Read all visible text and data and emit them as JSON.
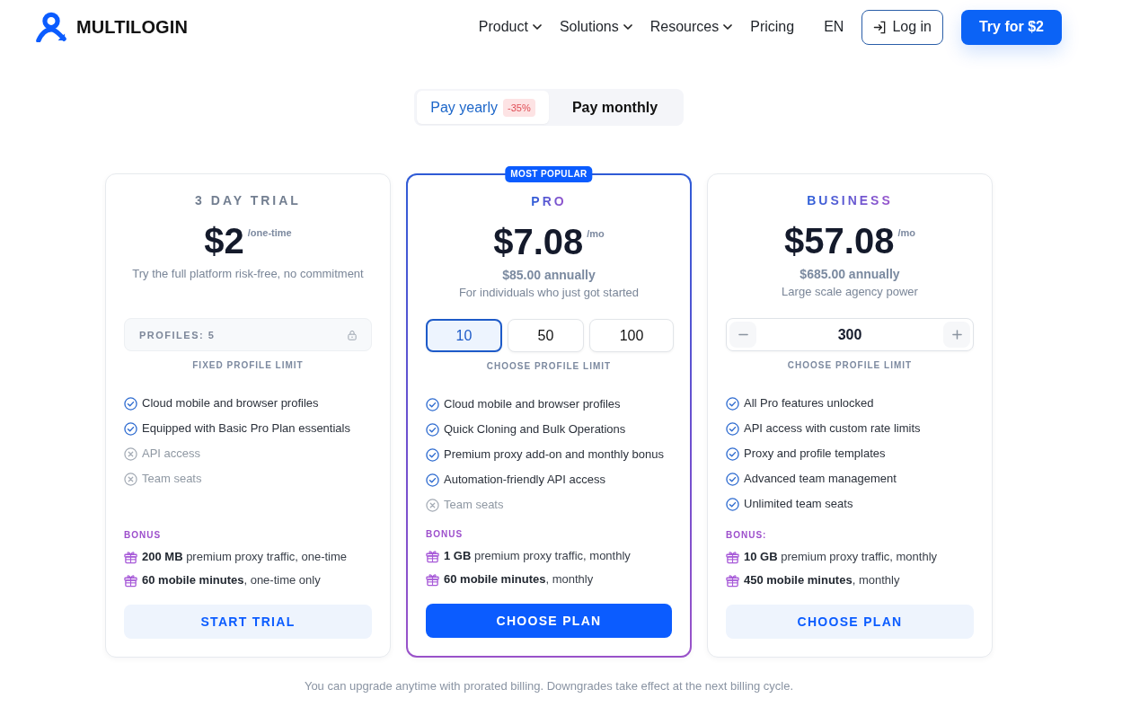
{
  "header": {
    "logo": "MULTILOGIN",
    "nav": [
      {
        "label": "Product",
        "dropdown": true
      },
      {
        "label": "Solutions",
        "dropdown": true
      },
      {
        "label": "Resources",
        "dropdown": true
      },
      {
        "label": "Pricing",
        "dropdown": false
      }
    ],
    "language": "EN",
    "login": "Log in",
    "cta": "Try for $2"
  },
  "billing_toggle": [
    {
      "label": "Pay yearly",
      "badge": "-35%",
      "selected": true
    },
    {
      "label": "Pay monthly",
      "selected": false
    }
  ],
  "plans": [
    {
      "name": "3 DAY TRIAL",
      "accent": false,
      "featured": false,
      "price": "$2",
      "period": "/one-time",
      "tagline": "Try the full platform risk-free, no commitment",
      "profile_limit": {
        "kind": "fixed",
        "value": "PROFILES: 5",
        "locked": true,
        "caption": "FIXED PROFILE LIMIT"
      },
      "features": [
        {
          "text": "Cloud mobile and browser profiles",
          "included": true
        },
        {
          "text": "Equipped with Basic Pro Plan essentials",
          "included": true
        },
        {
          "text": "API access",
          "included": false
        },
        {
          "text": "Team seats",
          "included": false
        }
      ],
      "bonus_label": "BONUS",
      "bonuses": [
        "**200 MB** premium proxy traffic, one-time",
        "**60 mobile minutes**, one-time only"
      ],
      "button": "START TRIAL"
    },
    {
      "name": "PRO",
      "accent": true,
      "featured": true,
      "ribbon": "MOST POPULAR",
      "price": "$7.08",
      "period": "/mo",
      "annual": "$85.00 annually",
      "tagline": "For individuals who just got started",
      "profile_limit": {
        "kind": "options",
        "options": [
          {
            "label": "10",
            "selected": true
          },
          {
            "label": "50",
            "selected": false
          },
          {
            "label": "100",
            "selected": false
          }
        ],
        "caption": "CHOOSE PROFILE LIMIT"
      },
      "features": [
        {
          "text": "Cloud mobile and browser profiles",
          "included": true
        },
        {
          "text": "Quick Cloning and Bulk Operations",
          "included": true
        },
        {
          "text": "Premium proxy add-on and monthly bonus",
          "included": true
        },
        {
          "text": "Automation-friendly API access",
          "included": true
        },
        {
          "text": "Team seats",
          "included": false
        }
      ],
      "bonus_label": "BONUS",
      "bonuses": [
        "**1 GB** premium proxy traffic, monthly",
        "**60 mobile minutes**, monthly"
      ],
      "button": "CHOOSE PLAN"
    },
    {
      "name": "BUSINESS",
      "accent": true,
      "featured": false,
      "price": "$57.08",
      "period": "/mo",
      "annual": "$685.00 annually",
      "tagline": "Large scale agency power",
      "profile_limit": {
        "kind": "stepper",
        "value": "300",
        "caption": "CHOOSE PROFILE LIMIT"
      },
      "features": [
        {
          "text": "All Pro features unlocked",
          "included": true
        },
        {
          "text": "API access with custom rate limits",
          "included": true
        },
        {
          "text": "Proxy and profile templates",
          "included": true
        },
        {
          "text": "Advanced team management",
          "included": true
        },
        {
          "text": "Unlimited team seats",
          "included": true
        }
      ],
      "bonus_label": "BONUS:",
      "bonuses": [
        "**10 GB** premium proxy traffic, monthly",
        "**450 mobile minutes**, monthly"
      ],
      "button": "CHOOSE PLAN"
    }
  ],
  "footnote": "You can upgrade anytime with prorated billing. Downgrades take effect at the next billing cycle."
}
